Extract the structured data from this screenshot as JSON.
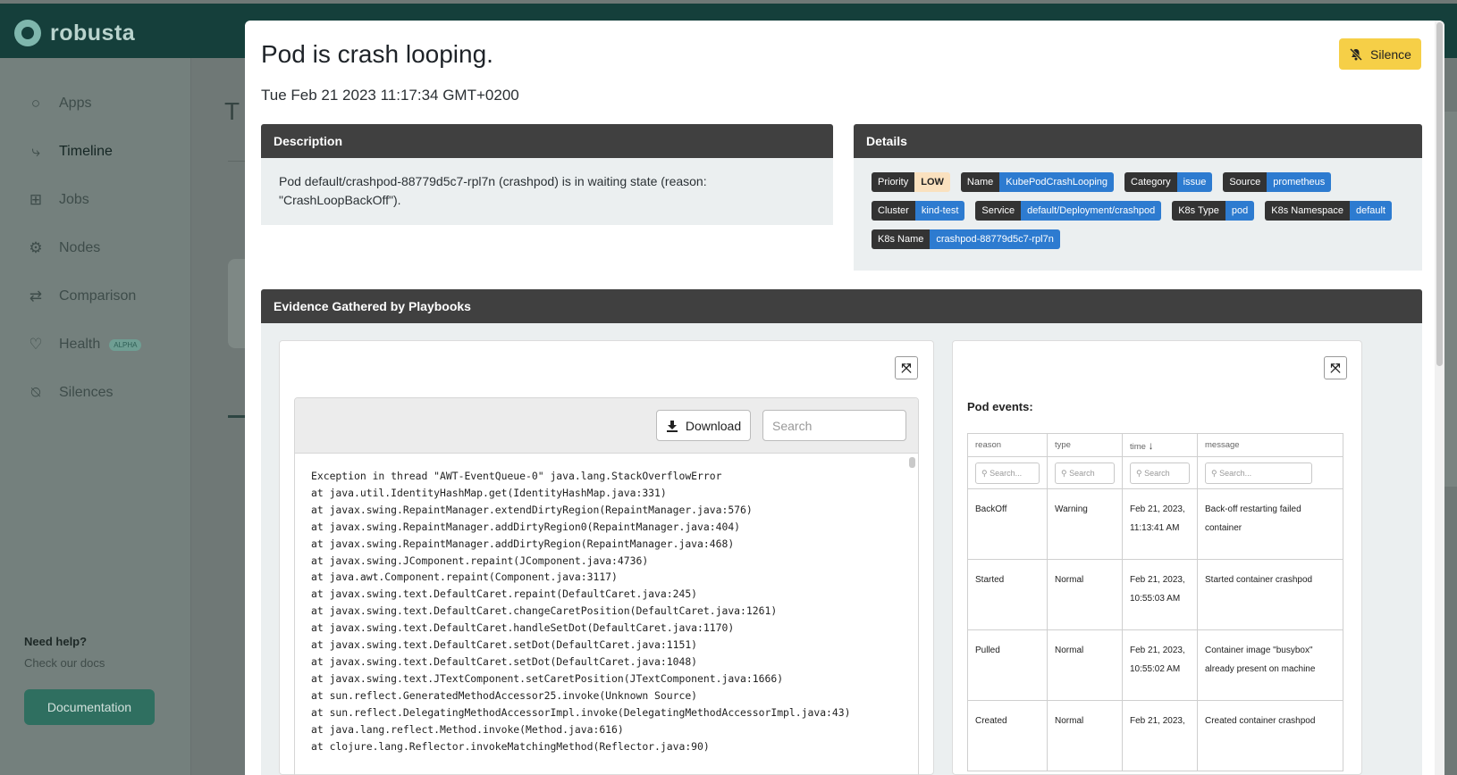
{
  "app": {
    "logo_text": "robusta",
    "page_title_initial": "T",
    "nav": [
      {
        "label": "Apps",
        "icon": "apps-icon"
      },
      {
        "label": "Timeline",
        "icon": "timeline-icon"
      },
      {
        "label": "Jobs",
        "icon": "jobs-icon"
      },
      {
        "label": "Nodes",
        "icon": "nodes-icon"
      },
      {
        "label": "Comparison",
        "icon": "comparison-icon"
      },
      {
        "label": "Health",
        "icon": "health-icon",
        "badge": "ALPHA"
      },
      {
        "label": "Silences",
        "icon": "silences-icon"
      }
    ],
    "help_title": "Need help?",
    "help_subtitle": "Check our docs",
    "documentation_button": "Documentation"
  },
  "modal": {
    "title": "Pod is crash looping.",
    "timestamp": "Tue Feb 21 2023 11:17:34 GMT+0200",
    "silence_button": "Silence",
    "description": {
      "header": "Description",
      "text": "Pod default/crashpod-88779d5c7-rpl7n (crashpod) is in waiting state (reason: \"CrashLoopBackOff\")."
    },
    "details": {
      "header": "Details",
      "tags": [
        {
          "key": "Priority",
          "value": "LOW"
        },
        {
          "key": "Name",
          "value": "KubePodCrashLooping"
        },
        {
          "key": "Category",
          "value": "issue"
        },
        {
          "key": "Source",
          "value": "prometheus"
        },
        {
          "key": "Cluster",
          "value": "kind-test"
        },
        {
          "key": "Service",
          "value": "default/Deployment/crashpod"
        },
        {
          "key": "K8s Type",
          "value": "pod"
        },
        {
          "key": "K8s Namespace",
          "value": "default"
        },
        {
          "key": "K8s Name",
          "value": "crashpod-88779d5c7-rpl7n"
        }
      ]
    },
    "evidence": {
      "header": "Evidence Gathered by Playbooks",
      "logs": {
        "download_button": "Download",
        "search_placeholder": "Search",
        "lines": [
          "Exception in thread \"AWT-EventQueue-0\" java.lang.StackOverflowError",
          "at java.util.IdentityHashMap.get(IdentityHashMap.java:331)",
          "at javax.swing.RepaintManager.extendDirtyRegion(RepaintManager.java:576)",
          "at javax.swing.RepaintManager.addDirtyRegion0(RepaintManager.java:404)",
          "at javax.swing.RepaintManager.addDirtyRegion(RepaintManager.java:468)",
          "at javax.swing.JComponent.repaint(JComponent.java:4736)",
          "at java.awt.Component.repaint(Component.java:3117)",
          "at javax.swing.text.DefaultCaret.repaint(DefaultCaret.java:245)",
          "at javax.swing.text.DefaultCaret.changeCaretPosition(DefaultCaret.java:1261)",
          "at javax.swing.text.DefaultCaret.handleSetDot(DefaultCaret.java:1170)",
          "at javax.swing.text.DefaultCaret.setDot(DefaultCaret.java:1151)",
          "at javax.swing.text.DefaultCaret.setDot(DefaultCaret.java:1048)",
          "at javax.swing.text.JTextComponent.setCaretPosition(JTextComponent.java:1666)",
          "at sun.reflect.GeneratedMethodAccessor25.invoke(Unknown Source)",
          "at sun.reflect.DelegatingMethodAccessorImpl.invoke(DelegatingMethodAccessorImpl.java:43)",
          "at java.lang.reflect.Method.invoke(Method.java:616)",
          "at clojure.lang.Reflector.invokeMatchingMethod(Reflector.java:90)"
        ]
      },
      "events": {
        "title": "Pod events:",
        "columns": [
          "reason",
          "type",
          "time",
          "message"
        ],
        "filter_placeholder": "Search...",
        "filter_placeholder_short": "Search",
        "rows": [
          {
            "reason": "BackOff",
            "type": "Warning",
            "time": [
              "Feb 21, 2023,",
              "11:13:41 AM"
            ],
            "message": [
              "Back-off restarting failed",
              "container"
            ]
          },
          {
            "reason": "Started",
            "type": "Normal",
            "time": [
              "Feb 21, 2023,",
              "10:55:03 AM"
            ],
            "message": [
              "Started container crashpod"
            ]
          },
          {
            "reason": "Pulled",
            "type": "Normal",
            "time": [
              "Feb 21, 2023,",
              "10:55:02 AM"
            ],
            "message": [
              "Container image \"busybox\"",
              "already present on machine"
            ]
          },
          {
            "reason": "Created",
            "type": "Normal",
            "time": [
              "Feb 21, 2023,"
            ],
            "message": [
              "Created container crashpod"
            ]
          }
        ]
      }
    }
  }
}
